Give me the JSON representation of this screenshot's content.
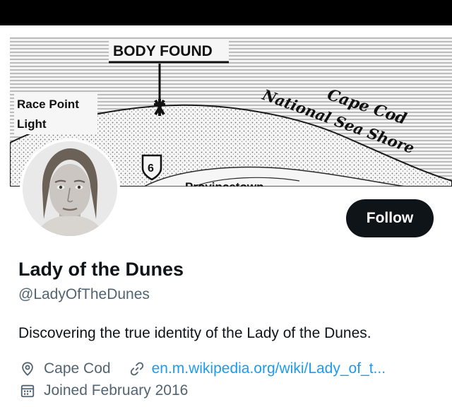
{
  "banner": {
    "headline": "BODY FOUND",
    "landmark": "Race Point",
    "landmark_line2": "Light",
    "route_marker": "6",
    "region_line1": "Cape Cod",
    "region_line2": "National Sea Shore",
    "town_fragment": "Provincetown"
  },
  "profile": {
    "display_name": "Lady of the Dunes",
    "handle": "@LadyOfTheDunes",
    "bio": "Discovering the true identity of the Lady of the Dunes.",
    "location": "Cape Cod",
    "website": "en.m.wikipedia.org/wiki/Lady_of_t...",
    "joined": "Joined February 2016"
  },
  "actions": {
    "follow_label": "Follow"
  },
  "icons": {
    "location": "location-pin-icon",
    "link": "link-icon",
    "joined": "calendar-icon"
  },
  "colors": {
    "text_primary": "#0f1419",
    "text_secondary": "#536471",
    "link": "#1d9bf0",
    "button_bg": "#0f1419",
    "button_text": "#ffffff"
  }
}
